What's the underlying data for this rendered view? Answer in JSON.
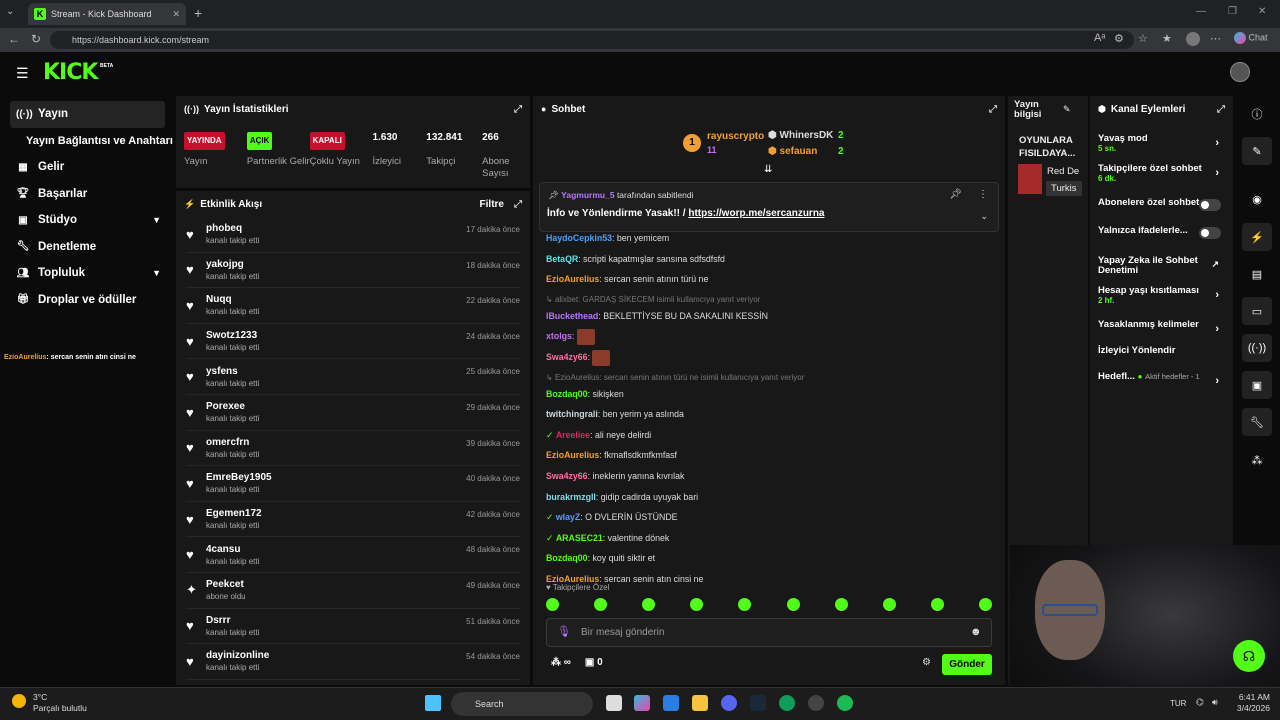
{
  "browser": {
    "tab_title": "Stream - Kick Dashboard",
    "url": "https://dashboard.kick.com/stream",
    "profile_label": "Chat"
  },
  "kick": {
    "logo": "KICK",
    "beta": "BETA",
    "brand_color": "#53fc18"
  },
  "nav": {
    "items": [
      {
        "label": "Yayın",
        "icon": "broadcast-icon",
        "active": true
      },
      {
        "label": "Yayın Bağlantısı ve Anahtarı",
        "icon": "",
        "sub": true
      },
      {
        "label": "Gelir",
        "icon": "money-icon"
      },
      {
        "label": "Başarılar",
        "icon": "trophy-icon"
      },
      {
        "label": "Stüdyo",
        "icon": "studio-icon",
        "chevron": true
      },
      {
        "label": "Denetleme",
        "icon": "wrench-icon"
      },
      {
        "label": "Topluluk",
        "icon": "community-icon",
        "chevron": true
      },
      {
        "label": "Droplar ve ödüller",
        "icon": "gift-icon"
      }
    ],
    "overlay_chat": {
      "user": "EzioAurelius",
      "text": ": sercan senin atın cinsi ne"
    }
  },
  "stats": {
    "title": "Yayın İstatistikleri",
    "items": [
      {
        "badge": "YAYINDA",
        "badge_color": "red",
        "label": "Yayın"
      },
      {
        "badge": "AÇIK",
        "badge_color": "green",
        "label": "Partnerlik Gelir"
      },
      {
        "badge": "KAPALI",
        "badge_color": "red",
        "label": "Çoklu Yayın"
      },
      {
        "value": "1.630",
        "label": "İzleyici"
      },
      {
        "value": "132.841",
        "label": "Takipçi"
      },
      {
        "value": "266",
        "label": "Abone Sayısı"
      }
    ]
  },
  "activity": {
    "title": "Etkinlik Akışı",
    "filter": "Filtre",
    "items": [
      {
        "name": "phobeq",
        "sub": "kanalı takip etti",
        "time": "17 dakika önce",
        "icon": "heart-icon"
      },
      {
        "name": "yakojpg",
        "sub": "kanalı takip etti",
        "time": "18 dakika önce",
        "icon": "heart-icon"
      },
      {
        "name": "Nuqq",
        "sub": "kanalı takip etti",
        "time": "22 dakika önce",
        "icon": "heart-icon"
      },
      {
        "name": "Swotz1233",
        "sub": "kanalı takip etti",
        "time": "24 dakika önce",
        "icon": "heart-icon"
      },
      {
        "name": "ysfens",
        "sub": "kanalı takip etti",
        "time": "25 dakika önce",
        "icon": "heart-icon"
      },
      {
        "name": "Porexee",
        "sub": "kanalı takip etti",
        "time": "29 dakika önce",
        "icon": "heart-icon"
      },
      {
        "name": "omercfrn",
        "sub": "kanalı takip etti",
        "time": "39 dakika önce",
        "icon": "heart-icon"
      },
      {
        "name": "EmreBey1905",
        "sub": "kanalı takip etti",
        "time": "40 dakika önce",
        "icon": "heart-icon"
      },
      {
        "name": "Egemen172",
        "sub": "kanalı takip etti",
        "time": "42 dakika önce",
        "icon": "heart-icon"
      },
      {
        "name": "4cansu",
        "sub": "kanalı takip etti",
        "time": "48 dakika önce",
        "icon": "heart-icon"
      },
      {
        "name": "Peekcet",
        "sub": "abone oldu",
        "time": "49 dakika önce",
        "icon": "sparkle-icon"
      },
      {
        "name": "Dsrrr",
        "sub": "kanalı takip etti",
        "time": "51 dakika önce",
        "icon": "heart-icon"
      },
      {
        "name": "dayinizonline",
        "sub": "kanalı takip etti",
        "time": "54 dakika önce",
        "icon": "heart-icon"
      }
    ]
  },
  "chat": {
    "title": "Sohbet",
    "leaders": [
      {
        "name": "rayuscrypto",
        "count": "11",
        "rank": "1"
      },
      {
        "name": "WhinersDK",
        "count": "2"
      },
      {
        "name": "sefauan",
        "count": "2"
      }
    ],
    "pinned": {
      "by_user": "Yagmurmu_5",
      "by_suffix": "tarafından sabitlendi",
      "text": "İnfo ve Yönlendirme Yasak!! / ",
      "link": "https://worp.me/sercanzurna"
    },
    "messages": [
      {
        "user": "HaydoCepkin53",
        "color": "#4a9eff",
        "text": ": ben yemicem"
      },
      {
        "user": "BetaQR",
        "color": "#5ce1e6",
        "text": ": scripti kapatmışlar sansına sdfsdfsfd"
      },
      {
        "user": "EzioAurelius",
        "color": "#f0a030",
        "text": ": sercan senin atının türü ne"
      },
      {
        "reply": "alixbet: GARDAŞ SİKECEM isimli kullanıcıya yanıt veriyor"
      },
      {
        "user": "lBuckethead",
        "color": "#b777ff",
        "text": ": BEKLETTİYSE BU DA SAKALINI KESSİN"
      },
      {
        "user": "xtolgs",
        "color": "#c56cf0",
        "text": ":",
        "emote": true
      },
      {
        "user": "Swa4zy66",
        "color": "#ff6fa5",
        "text": ":",
        "emote": true
      },
      {
        "reply": "EzioAurelius: sercan senin atının türü ne isimli kullanıcıya yanıt veriyor"
      },
      {
        "user": "Bozdaq00",
        "color": "#53fc18",
        "text": ": sikişken"
      },
      {
        "user": "twitchingrali",
        "color": "#cfd8dc",
        "text": ": ben yerim ya aslında"
      },
      {
        "user": "Areeliee",
        "color": "#e0245e",
        "text": ": ali neye delirdi",
        "badge": true
      },
      {
        "user": "EzioAurelius",
        "color": "#f0a030",
        "text": ": fkmaflsdkmfkmfasf"
      },
      {
        "user": "Swa4zy66",
        "color": "#ff6fa5",
        "text": ": ineklerin yanına kıvrılak"
      },
      {
        "user": "burakrmzgll",
        "color": "#80deea",
        "text": ": gidip cadirda uyuyak bari"
      },
      {
        "user": "wlayZ",
        "color": "#5c9bff",
        "text": ": O DVLERİN ÜSTÜNDE",
        "badge": true
      },
      {
        "user": "ARASEC21",
        "color": "#53fc18",
        "text": ": valentine dönek",
        "badge": true
      },
      {
        "user": "Bozdaq00",
        "color": "#53fc18",
        "text": ": koy quiti siktir et"
      },
      {
        "user": "EzioAurelius",
        "color": "#f0a030",
        "text": ": sercan senin atın cinsi ne"
      }
    ],
    "followers_only": "Takipçilere Özel",
    "input_placeholder": "Bir mesaj gönderin",
    "points": "∞",
    "gifts": "0",
    "send": "Gönder"
  },
  "stream_info": {
    "title": "Yayın bilgisi",
    "stream_title": "OYUNLARA FISILDAYA...",
    "game": "Red De",
    "language": "Turkis"
  },
  "channel_actions": {
    "title": "Kanal Eylemleri",
    "items": [
      {
        "label": "Yavaş mod",
        "sub": "5 sn.",
        "control": "arrow"
      },
      {
        "label": "Takipçilere özel sohbet",
        "sub": "6 dk.",
        "control": "arrow"
      },
      {
        "label": "Abonelere özel sohbet",
        "control": "toggle"
      },
      {
        "label": "Yalnızca ifadelerle...",
        "control": "toggle"
      },
      {
        "label": "Yapay Zeka ile Sohbet Denetimi",
        "control": "external"
      },
      {
        "label": "Hesap yaşı kısıtlaması",
        "sub": "2 hf.",
        "control": "arrow"
      },
      {
        "label": "Yasaklanmış kelimeler",
        "control": "arrow"
      },
      {
        "label": "İzleyici Yönlendir",
        "control": "none"
      },
      {
        "label": "Hedefl...",
        "extra": "Aktif hedefler - 1",
        "control": "arrow"
      }
    ]
  },
  "taskbar": {
    "temp": "3°C",
    "weather": "Parçalı bulutlu",
    "search": "Search",
    "lang": "TUR",
    "time": "6:41 AM",
    "date": "3/4/2026"
  }
}
